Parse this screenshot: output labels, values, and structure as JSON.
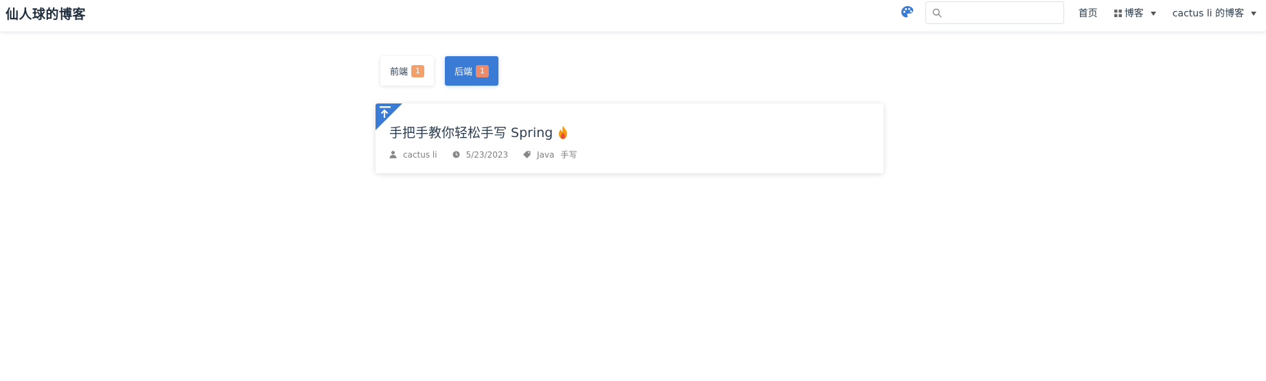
{
  "header": {
    "site_name": "仙人球的博客",
    "search": {
      "value": "",
      "placeholder": ""
    },
    "nav": {
      "home": "首页",
      "blog": "博客",
      "profile": "cactus li 的博客"
    }
  },
  "categories": [
    {
      "label": "前端",
      "count": "1",
      "active": false
    },
    {
      "label": "后端",
      "count": "1",
      "active": true
    }
  ],
  "post": {
    "title": "手把手教你轻松手写 Spring",
    "author": "cactus li",
    "date": "5/23/2023",
    "tags": [
      "Java",
      "手写"
    ]
  },
  "colors": {
    "accent": "#3a7bd5",
    "count_badge": "#f2a06c",
    "text": "#2c3e50",
    "meta": "#7f7f7f"
  },
  "icons": {
    "theme": "palette-icon",
    "search": "search-icon",
    "blog_menu": "grid-icon",
    "sticky": "pin-top-icon",
    "hot": "flame-icon",
    "author": "user-icon",
    "date": "clock-icon",
    "tags": "tag-icon"
  }
}
